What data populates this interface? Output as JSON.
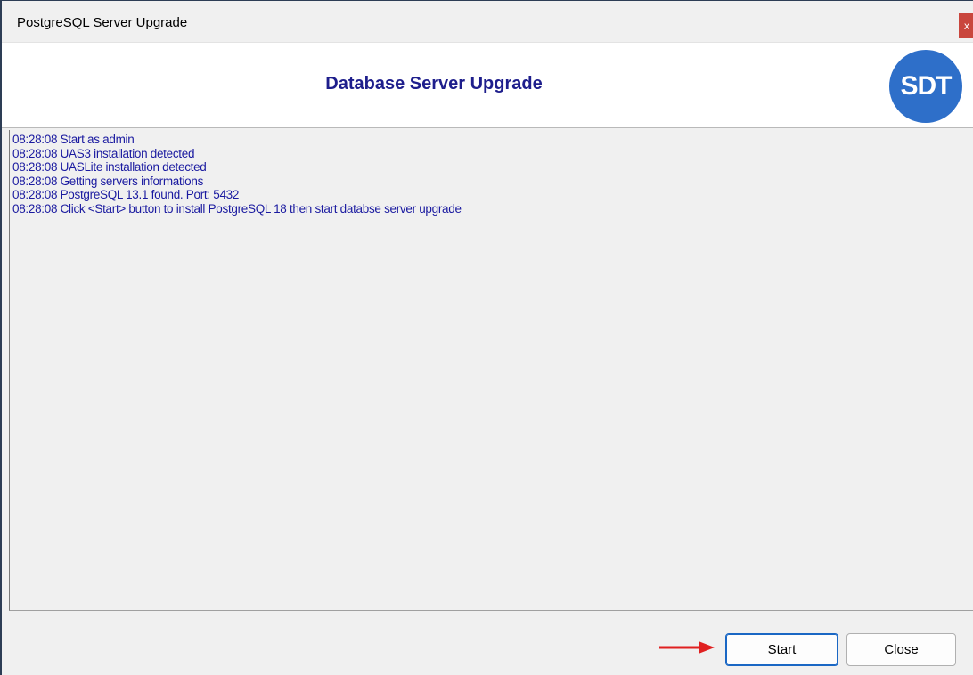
{
  "window": {
    "title": "PostgreSQL Server Upgrade",
    "close_glyph": "x"
  },
  "header": {
    "title": "Database Server Upgrade",
    "logo_text": "SDT"
  },
  "log": {
    "lines": [
      "08:28:08 Start as admin",
      "08:28:08 UAS3 installation detected",
      "08:28:08 UASLite installation detected",
      "08:28:08 Getting servers informations",
      "08:28:08 PostgreSQL 13.1 found. Port: 5432",
      "08:28:08 Click <Start> button to install PostgreSQL 18 then start databse server upgrade"
    ]
  },
  "buttons": {
    "start_label": "Start",
    "close_label": "Close"
  },
  "colors": {
    "log_text": "#1a1aa0",
    "header_title": "#1e1e8c",
    "logo_bg": "#2e6fc9",
    "annotation_arrow": "#e02020",
    "close_button_bg": "#c9463d"
  },
  "icons": {
    "close": "close-icon",
    "logo": "sdt-logo",
    "annotation": "red-arrow-icon"
  }
}
